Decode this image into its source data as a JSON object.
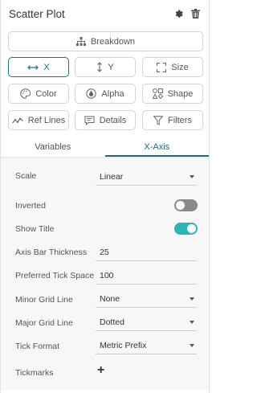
{
  "header": {
    "title": "Scatter Plot",
    "gear_icon": "gear-icon",
    "trash_icon": "trash-icon"
  },
  "buttons": {
    "breakdown": "Breakdown",
    "x": "X",
    "y": "Y",
    "size": "Size",
    "color": "Color",
    "alpha": "Alpha",
    "shape": "Shape",
    "ref_lines": "Ref Lines",
    "details": "Details",
    "filters": "Filters"
  },
  "tabs": {
    "variables": "Variables",
    "x_axis": "X-Axis",
    "active": "X-Axis"
  },
  "colors": {
    "accent": "#1f6f88",
    "toggle_on": "#2bb5b5",
    "toggle_off": "#8a8a8a"
  },
  "settings": {
    "scale": {
      "label": "Scale",
      "value": "Linear"
    },
    "inverted": {
      "label": "Inverted",
      "enabled": false
    },
    "show_title": {
      "label": "Show Title",
      "enabled": true
    },
    "axis_bar_thickness": {
      "label": "Axis Bar Thickness",
      "value": "25"
    },
    "preferred_tick_space": {
      "label": "Preferred Tick Space",
      "value": "100"
    },
    "minor_grid_line": {
      "label": "Minor Grid Line",
      "value": "None"
    },
    "major_grid_line": {
      "label": "Major Grid Line",
      "value": "Dotted"
    },
    "tick_format": {
      "label": "Tick Format",
      "value": "Metric Prefix"
    },
    "tickmarks": {
      "label": "Tickmarks",
      "add_symbol": "+"
    }
  }
}
